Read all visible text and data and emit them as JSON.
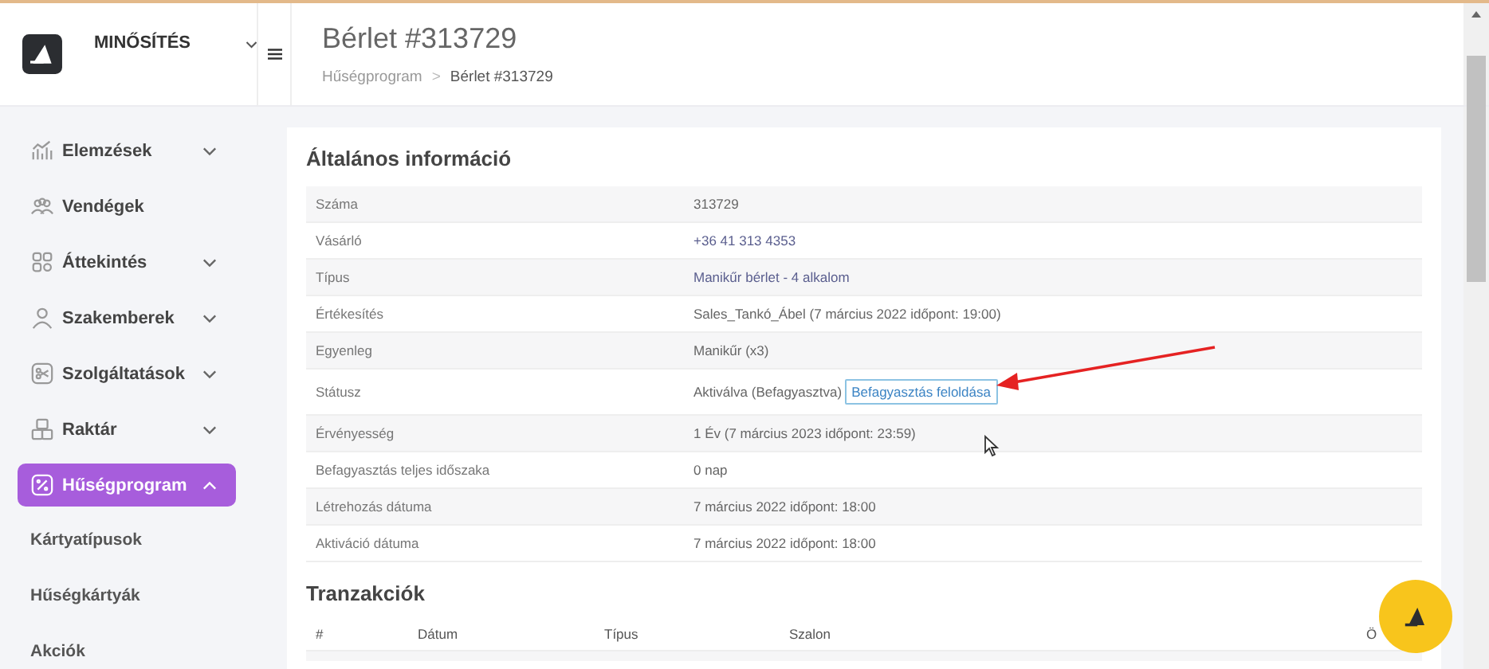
{
  "brand": {
    "name": "MINŐSÍTÉS"
  },
  "header": {
    "title": "Bérlet #313729",
    "separator": ">",
    "breadcrumb": [
      {
        "label": "Hűségprogram",
        "current": false
      },
      {
        "label": "Bérlet #313729",
        "current": true
      }
    ]
  },
  "sidebar": {
    "items": [
      {
        "label": "Elemzések",
        "kind": "group",
        "selected": false,
        "expanded": false
      },
      {
        "label": "Vendégek",
        "kind": "link",
        "selected": false
      },
      {
        "label": "Áttekintés",
        "kind": "group",
        "selected": false,
        "expanded": false
      },
      {
        "label": "Szakemberek",
        "kind": "group",
        "selected": false,
        "expanded": false
      },
      {
        "label": "Szolgáltatások",
        "kind": "group",
        "selected": false,
        "expanded": false
      },
      {
        "label": "Raktár",
        "kind": "group",
        "selected": false,
        "expanded": false
      },
      {
        "label": "Hűségprogram",
        "kind": "group",
        "selected": true,
        "expanded": true,
        "children": [
          {
            "label": "Kártyatípusok"
          },
          {
            "label": "Hűségkártyák"
          },
          {
            "label": "Akciók"
          }
        ]
      }
    ]
  },
  "info": {
    "title": "Általános információ",
    "rows": [
      {
        "label": "Száma",
        "kind": "text",
        "value": "313729"
      },
      {
        "label": "Vásárló",
        "kind": "link",
        "value": "+36 41 313 4353"
      },
      {
        "label": "Típus",
        "kind": "link",
        "value": "Manikűr bérlet - 4 alkalom"
      },
      {
        "label": "Értékesítés",
        "kind": "text",
        "value": "Sales_Tankó_Ábel (7 március 2022 időpont: 19:00)"
      },
      {
        "label": "Egyenleg",
        "kind": "text",
        "value": "Manikűr (x3)"
      },
      {
        "label": "Státusz",
        "kind": "status",
        "value": "Aktiválva (Befagyasztva)",
        "button": "Befagyasztás feloldása"
      },
      {
        "label": "Érvényesség",
        "kind": "text",
        "value": "1 Év (7 március 2023 időpont: 23:59)"
      },
      {
        "label": "Befagyasztás teljes időszaka",
        "kind": "text",
        "value": "0 nap"
      },
      {
        "label": "Létrehozás dátuma",
        "kind": "text",
        "value": "7 március 2022 időpont: 18:00"
      },
      {
        "label": "Aktiváció dátuma",
        "kind": "text",
        "value": "7 március 2022 időpont: 18:00"
      }
    ]
  },
  "transactions": {
    "title": "Tranzakciók",
    "columns": [
      "#",
      "Dátum",
      "Típus",
      "Szalon",
      "Ö"
    ]
  }
}
